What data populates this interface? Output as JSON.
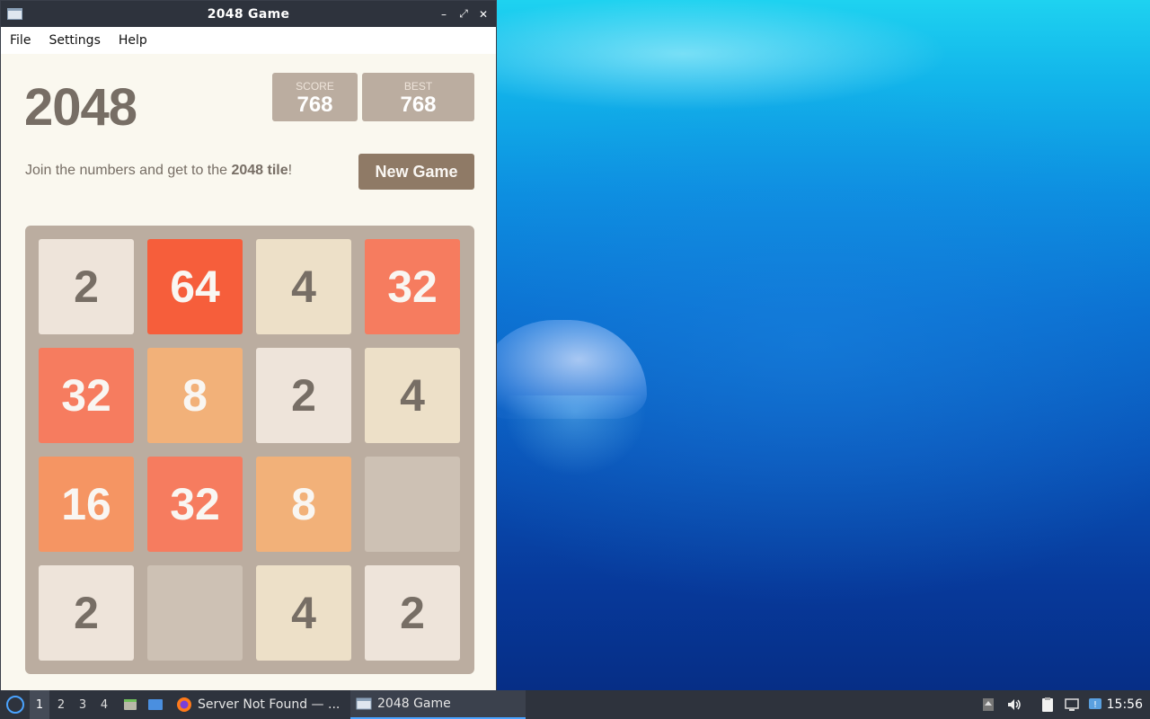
{
  "window": {
    "title": "2048 Game",
    "menu": [
      "File",
      "Settings",
      "Help"
    ]
  },
  "game": {
    "title": "2048",
    "score_label": "SCORE",
    "score_value": "768",
    "best_label": "BEST",
    "best_value": "768",
    "intro_prefix": "Join the numbers and get to the ",
    "intro_bold": "2048 tile",
    "intro_suffix": "!",
    "new_game_label": "New Game",
    "grid": [
      [
        "2",
        "64",
        "4",
        "32"
      ],
      [
        "32",
        "8",
        "2",
        "4"
      ],
      [
        "16",
        "32",
        "8",
        ""
      ],
      [
        "2",
        "",
        "4",
        "2"
      ]
    ]
  },
  "taskbar": {
    "workspaces": [
      "1",
      "2",
      "3",
      "4"
    ],
    "active_workspace": "1",
    "tasks": [
      {
        "label": "Server Not Found — ...",
        "icon": "firefox-icon"
      },
      {
        "label": "2048 Game",
        "icon": "window-icon",
        "active": true
      }
    ],
    "clock": "15:56"
  },
  "colors": {
    "titlebar": "#2e333d",
    "board": "#bbada0",
    "empty_cell": "#cdc1b4",
    "accent": "#4aa3ff"
  }
}
